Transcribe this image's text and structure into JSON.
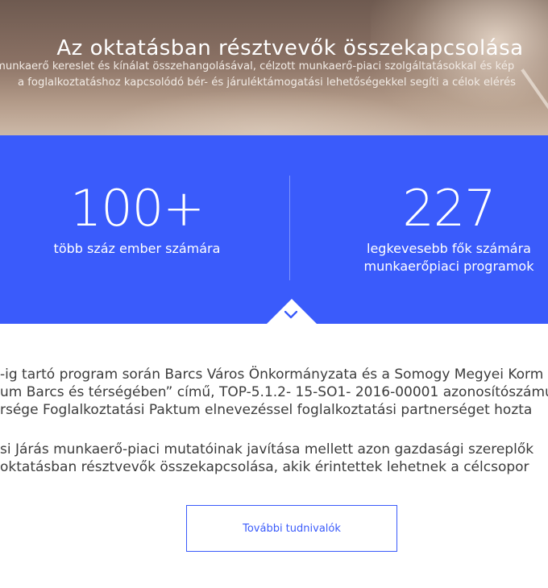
{
  "hero": {
    "title": "Az oktatásban résztvevők összekapcsolása",
    "lines": [
      "munkaerő kereslet és kínálat összehangolásával, célzott munkaerő-piaci szolgáltatásokkal és kép",
      "a foglalkoztatáshoz kapcsolódó bér- és járuléktámogatási lehetőségekkel segíti a célok elérés"
    ]
  },
  "stats": [
    {
      "value": "100+",
      "label": "több száz ember számára"
    },
    {
      "value": "227",
      "label": "legkevesebb fők számára munkaerőpiaci programok"
    }
  ],
  "paragraphs": [
    [
      "-ig tartó program során Barcs Város Önkormányzata és a Somogy Megyei Korm",
      "um Barcs és térségében” című, TOP-5.1.2- 15-SO1- 2016-00001 azonosítószámú",
      "rsége Foglalkoztatási Paktum elnevezéssel foglalkoztatási partnerséget hozta"
    ],
    [
      "si Járás munkaerő-piaci mutatóinak javítása mellett azon gazdasági szereplők",
      "oktatásban résztvevők összekapcsolása, akik érintettek lehetnek a célcsopor"
    ]
  ],
  "button": {
    "label": "További tudnivalók"
  },
  "colors": {
    "accent": "#3a5bfb",
    "text": "#3c3c3c"
  },
  "icons": {
    "scroll": "chevron-down-icon"
  }
}
